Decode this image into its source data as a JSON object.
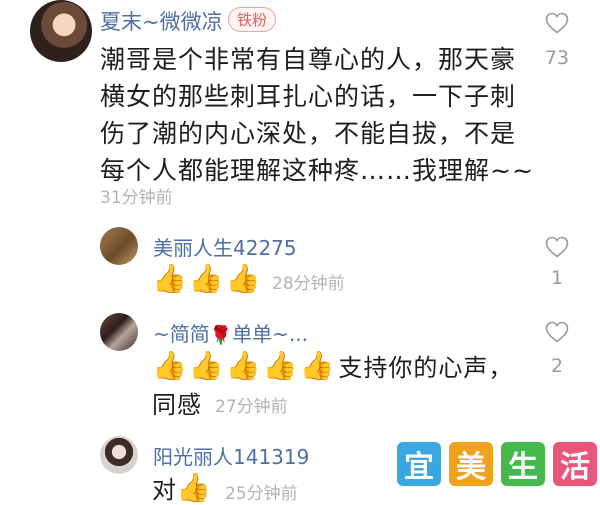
{
  "main_comment": {
    "user_name": "夏末~微微凉",
    "badge": "铁粉",
    "lines": [
      "潮哥是个非常有自尊心的人，那天豪",
      "横女的那些刺耳扎心的话，一下子刺",
      "伤了潮的内心深处，不能自拔，不是",
      "每个人都能理解这种疼……我理解~~"
    ],
    "time": "31分钟前",
    "likes": "73"
  },
  "replies": [
    {
      "user_name": "美丽人生42275",
      "emoji": [
        "👍",
        "👍",
        "👍"
      ],
      "time": "28分钟前",
      "likes": "1"
    },
    {
      "user_name_prefix": "~简简",
      "user_name_rose": "🌹",
      "user_name_suffix": "单单~...",
      "emoji": [
        "👍",
        "👍",
        "👍",
        "👍",
        "👍"
      ],
      "text_line1": "支持你的心声，",
      "text_line2": "同感",
      "time": "27分钟前",
      "likes": "2"
    },
    {
      "user_name": "阳光丽人141319",
      "text": "对",
      "emoji": [
        "👍"
      ],
      "time": "25分钟前"
    }
  ],
  "watermark": {
    "chars": [
      "宜",
      "美",
      "生",
      "活"
    ],
    "colors": [
      "#3aa7e0",
      "#f0a21e",
      "#45b94c",
      "#e8567c"
    ]
  },
  "colors": {
    "username": "#4f6ea3",
    "timestamp": "#b3b3b3",
    "badge": "#e0625f"
  }
}
